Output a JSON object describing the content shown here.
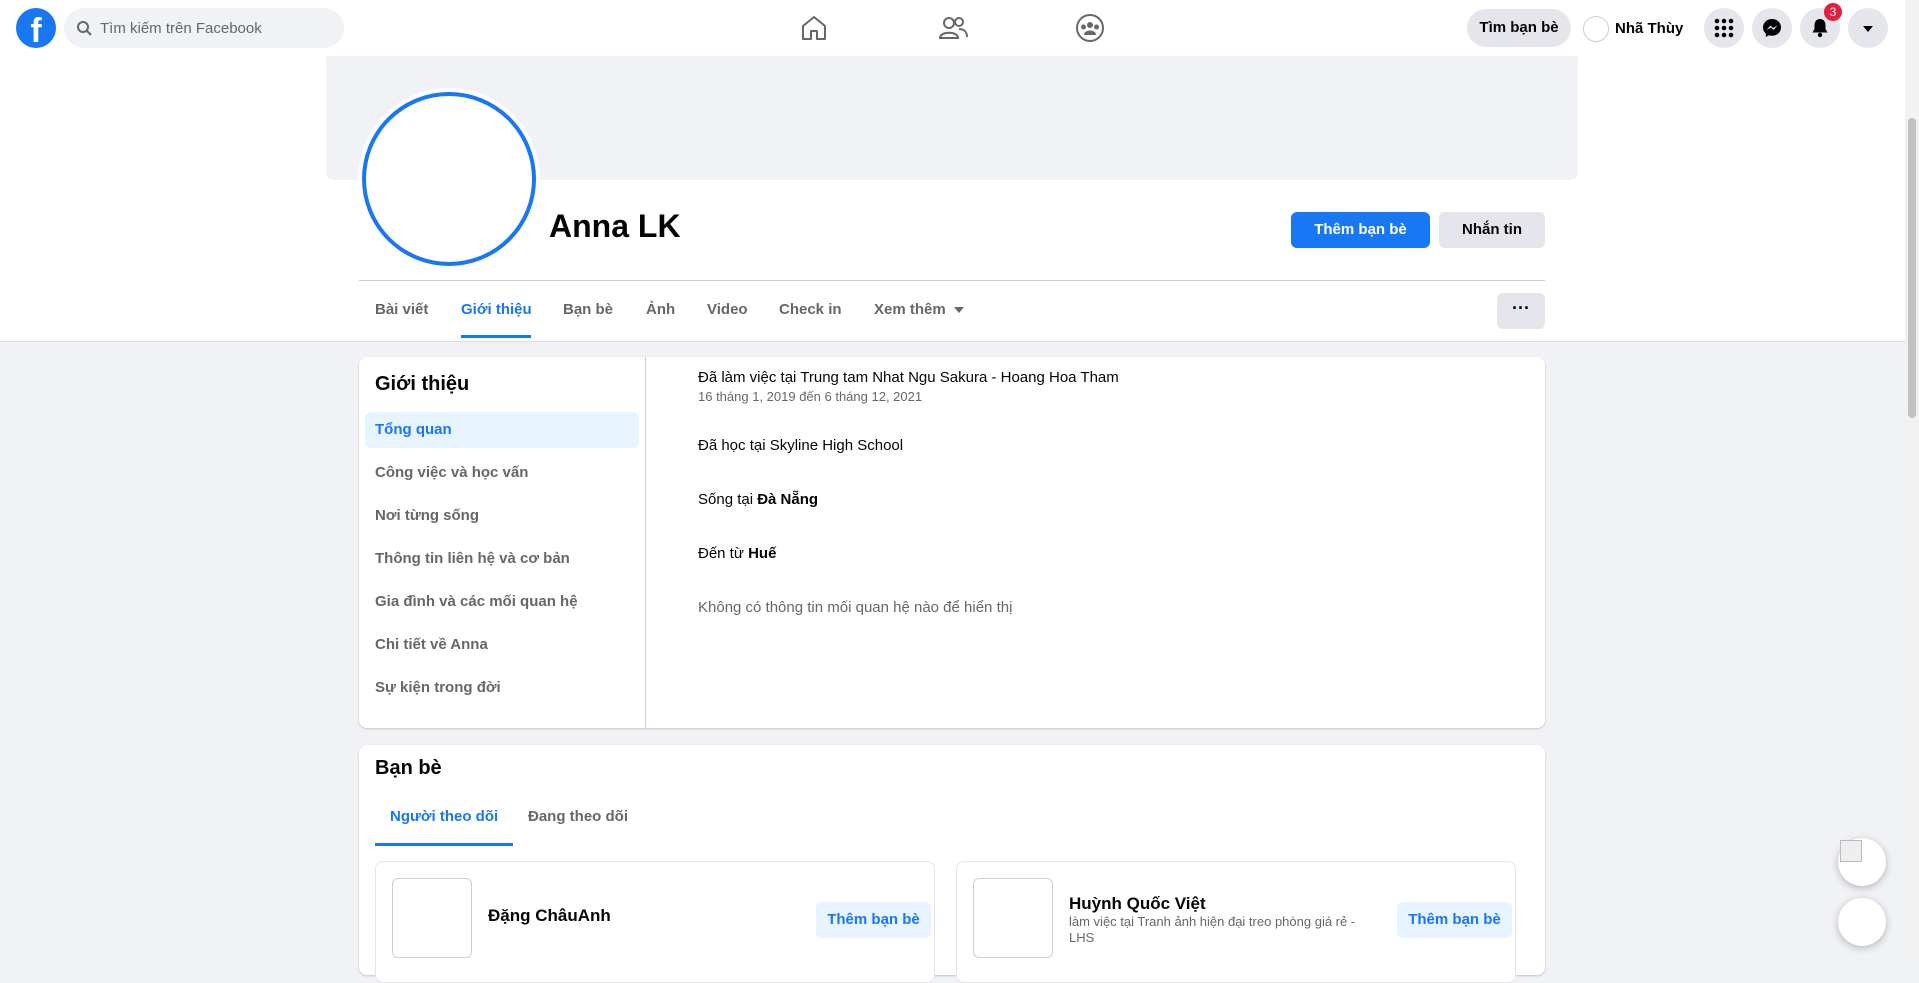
{
  "topbar": {
    "search_placeholder": "Tìm kiếm trên Facebook",
    "find_friends_label": "Tìm bạn bè",
    "user_name": "Nhã Thùy",
    "notification_count": "3",
    "brand_color": "#1877f2"
  },
  "profile": {
    "name": "Anna LK",
    "add_friend_label": "Thêm bạn bè",
    "message_label": "Nhắn tin",
    "more_label": "···",
    "tabs": [
      {
        "label": "Bài viết"
      },
      {
        "label": "Giới thiệu"
      },
      {
        "label": "Bạn bè"
      },
      {
        "label": "Ảnh"
      },
      {
        "label": "Video"
      },
      {
        "label": "Check in"
      },
      {
        "label": "Xem thêm"
      }
    ],
    "active_tab": "Giới thiệu"
  },
  "about": {
    "title": "Giới thiệu",
    "menu": [
      {
        "label": "Tổng quan"
      },
      {
        "label": "Công việc và học vấn"
      },
      {
        "label": "Nơi từng sống"
      },
      {
        "label": "Thông tin liên hệ và cơ bản"
      },
      {
        "label": "Gia đình và các mối quan hệ"
      },
      {
        "label": "Chi tiết về Anna"
      },
      {
        "label": "Sự kiện trong đời"
      }
    ],
    "work_text": "Đã làm việc tại Trung tam Nhat Ngu Sakura - Hoang Hoa Tham",
    "work_dates": "16 tháng 1, 2019 đến 6 tháng 12, 2021",
    "school_text": "Đã học tại Skyline High School",
    "lives_prefix": "Sống tại",
    "lives_place": "Đà Nẵng",
    "from_prefix": "Đến từ",
    "from_place": "Huế",
    "relationship_text": "Không có thông tin mối quan hệ nào để hiển thị"
  },
  "friends": {
    "title": "Bạn bè",
    "tabs": [
      {
        "label": "Người theo dõi"
      },
      {
        "label": "Đang theo dõi"
      }
    ],
    "items": [
      {
        "name": "Đặng ChâuAnh",
        "subtitle": "",
        "button": "Thêm bạn bè"
      },
      {
        "name": "Huỳnh Quốc Việt",
        "subtitle": "làm việc tại Tranh ảnh hiện đại treo phòng giá rẻ - LHS",
        "button": "Thêm bạn bè"
      }
    ]
  }
}
